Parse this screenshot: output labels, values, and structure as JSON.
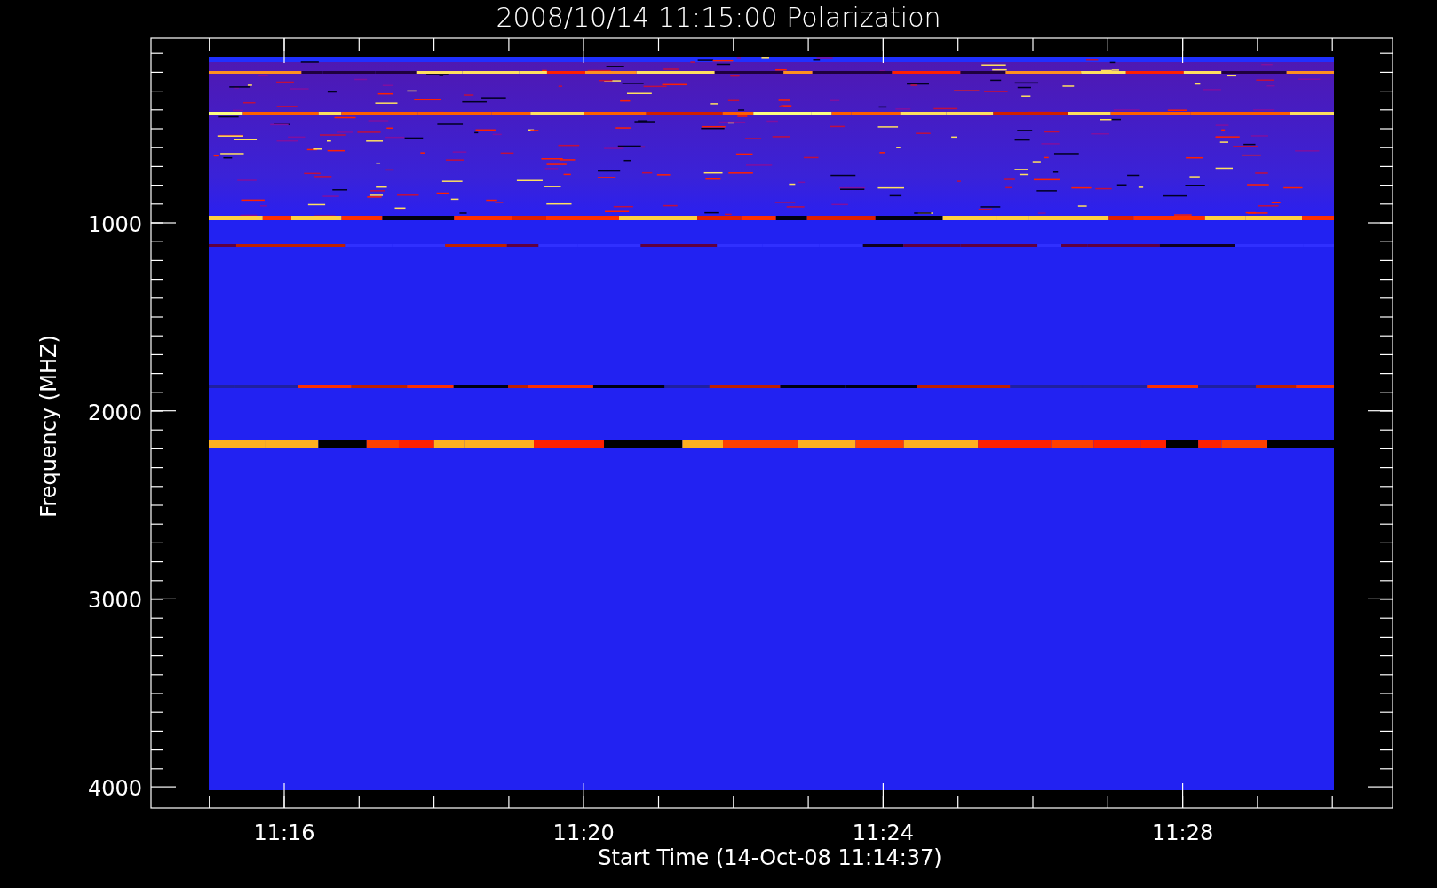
{
  "title": "2008/10/14 11:15:00 Polarization",
  "y_axis": {
    "label": "Frequency (MHZ)",
    "ticks": [
      "1000",
      "2000",
      "3000",
      "4000"
    ]
  },
  "x_axis": {
    "label": "Start Time (14-Oct-08 11:14:37)",
    "ticks": [
      "11:16",
      "11:20",
      "11:24",
      "11:28"
    ]
  }
}
